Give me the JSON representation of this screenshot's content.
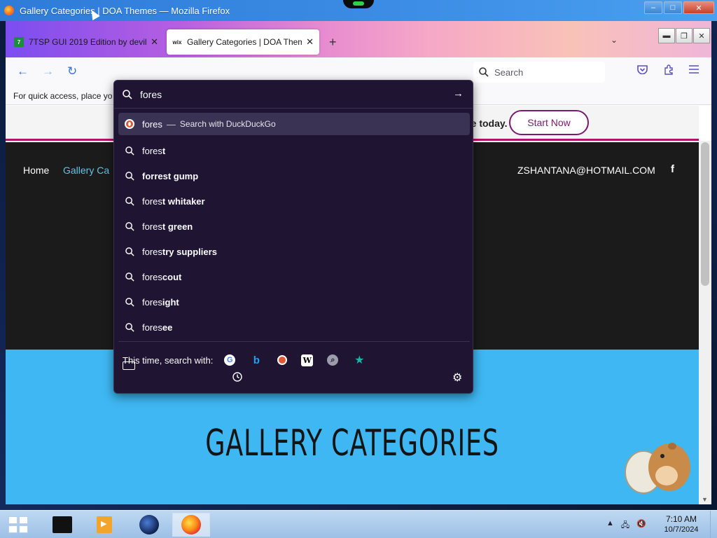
{
  "window": {
    "title": "Gallery Categories | DOA Themes — Mozilla Firefox",
    "min": "–",
    "max": "□",
    "close": "✕"
  },
  "tabs": [
    {
      "label": "7TSP GUI 2019 Edition by devil",
      "favicon": "7",
      "close": "✕"
    },
    {
      "label": "Gallery Categories | DOA Theme",
      "favicon": "wix",
      "close": "✕"
    }
  ],
  "tabbar": {
    "new_tab": "+",
    "list_tabs": "⌄",
    "inner_min": "▬",
    "inner_max": "❐",
    "inner_close": "✕"
  },
  "navbar": {
    "back": "←",
    "forward": "→",
    "reload": "↻",
    "search_placeholder": "Search"
  },
  "bookmarks_text": "For quick access, place yo",
  "urlbar": {
    "typed": "fores",
    "go": "→",
    "first": {
      "term": "fores",
      "sep": "—",
      "action": "Search with DuckDuckGo"
    },
    "suggestions": [
      {
        "prefix": "fores",
        "rest": "t"
      },
      {
        "prefix": "",
        "rest": "forrest gump"
      },
      {
        "prefix": "fores",
        "rest": "t whitaker"
      },
      {
        "prefix": "fores",
        "rest": "t green"
      },
      {
        "prefix": "fores",
        "rest": "try suppliers"
      },
      {
        "prefix": "fores",
        "rest": "cout"
      },
      {
        "prefix": "fores",
        "rest": "ight"
      },
      {
        "prefix": "fores",
        "rest": "ee"
      }
    ],
    "search_with_label": "This time, search with:",
    "engines": [
      {
        "name": "google-icon",
        "glyph": "G"
      },
      {
        "name": "bing-icon",
        "glyph": "b"
      },
      {
        "name": "duckduckgo-icon",
        "glyph": ""
      },
      {
        "name": "wikipedia-icon",
        "glyph": "W"
      },
      {
        "name": "magnifier-engine-icon",
        "glyph": "🔍"
      },
      {
        "name": "bookmarks-star-icon",
        "glyph": "★"
      },
      {
        "name": "tabs-icon",
        "glyph": ""
      }
    ]
  },
  "page": {
    "banner_text": "te today.",
    "start_now": "Start Now",
    "nav_home": "Home",
    "nav_gallery": "Gallery Ca",
    "email": "ZSHANTANA@HOTMAIL.COM",
    "facebook": "f",
    "gallery_title": "GALLERY CATEGORIES"
  },
  "taskbar": {
    "time": "7:10 AM",
    "date": "10/7/2024",
    "tray_up": "▲",
    "tray_net": "🖧",
    "tray_vol": "🔇"
  }
}
